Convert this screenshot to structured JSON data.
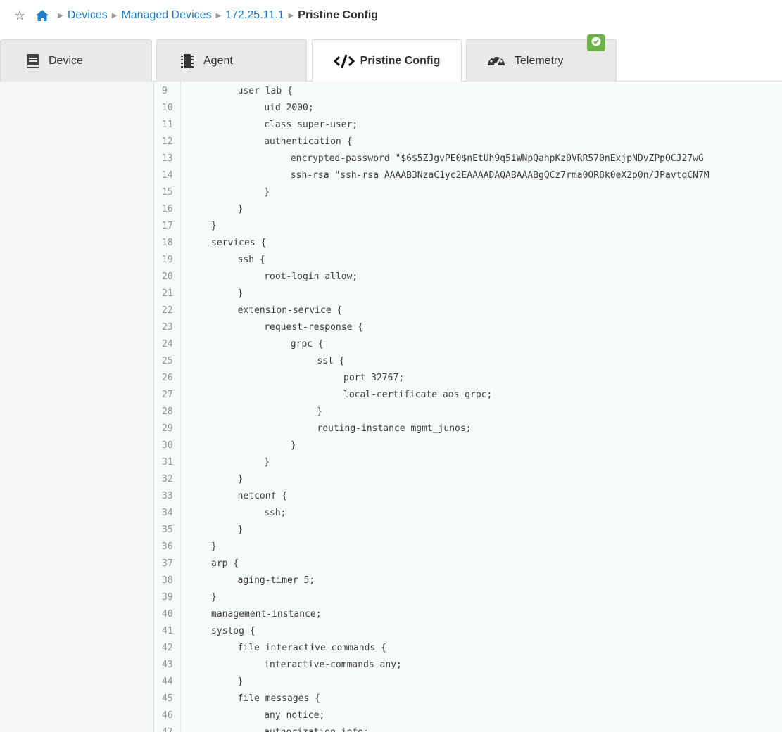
{
  "breadcrumb": {
    "items": [
      "Devices",
      "Managed Devices",
      "172.25.11.1"
    ],
    "current": "Pristine Config"
  },
  "tabs": [
    {
      "label": "Device",
      "icon": "book-icon"
    },
    {
      "label": "Agent",
      "icon": "chip-icon"
    },
    {
      "label": "Pristine Config",
      "icon": "code-icon",
      "active": true
    },
    {
      "label": "Telemetry",
      "icon": "gauge-icon"
    }
  ],
  "status_badge": {
    "icon": "check-circle-icon",
    "color": "#6bb342"
  },
  "code": {
    "lines": [
      {
        "n": "9",
        "indent": 4,
        "text": "user lab {"
      },
      {
        "n": "10",
        "indent": 8,
        "text": "uid 2000;"
      },
      {
        "n": "11",
        "indent": 8,
        "text": "class super-user;"
      },
      {
        "n": "12",
        "indent": 8,
        "text": "authentication {"
      },
      {
        "n": "13",
        "indent": 12,
        "text": "encrypted-password \"$6$5ZJgvPE0$nEtUh9q5iWNpQahpKz0VRR570nExjpNDvZPpOCJ27wG"
      },
      {
        "n": "14",
        "indent": 12,
        "text": "ssh-rsa \"ssh-rsa AAAAB3NzaC1yc2EAAAADAQABAAABgQCz7rma0OR8k0eX2p0n/JPavtqCN7M"
      },
      {
        "n": "15",
        "indent": 8,
        "text": "}"
      },
      {
        "n": "16",
        "indent": 4,
        "text": "}"
      },
      {
        "n": "17",
        "indent": 0,
        "text": "}"
      },
      {
        "n": "18",
        "indent": 0,
        "text": "services {"
      },
      {
        "n": "19",
        "indent": 4,
        "text": "ssh {"
      },
      {
        "n": "20",
        "indent": 8,
        "text": "root-login allow;"
      },
      {
        "n": "21",
        "indent": 4,
        "text": "}"
      },
      {
        "n": "22",
        "indent": 4,
        "text": "extension-service {"
      },
      {
        "n": "23",
        "indent": 8,
        "text": "request-response {"
      },
      {
        "n": "24",
        "indent": 12,
        "text": "grpc {"
      },
      {
        "n": "25",
        "indent": 16,
        "text": "ssl {"
      },
      {
        "n": "26",
        "indent": 20,
        "text": "port 32767;"
      },
      {
        "n": "27",
        "indent": 20,
        "text": "local-certificate aos_grpc;"
      },
      {
        "n": "28",
        "indent": 16,
        "text": "}"
      },
      {
        "n": "29",
        "indent": 16,
        "text": "routing-instance mgmt_junos;"
      },
      {
        "n": "30",
        "indent": 12,
        "text": "}"
      },
      {
        "n": "31",
        "indent": 8,
        "text": "}"
      },
      {
        "n": "32",
        "indent": 4,
        "text": "}"
      },
      {
        "n": "33",
        "indent": 4,
        "text": "netconf {"
      },
      {
        "n": "34",
        "indent": 8,
        "text": "ssh;"
      },
      {
        "n": "35",
        "indent": 4,
        "text": "}"
      },
      {
        "n": "36",
        "indent": 0,
        "text": "}"
      },
      {
        "n": "37",
        "indent": 0,
        "text": "arp {"
      },
      {
        "n": "38",
        "indent": 4,
        "text": "aging-timer 5;"
      },
      {
        "n": "39",
        "indent": 0,
        "text": "}"
      },
      {
        "n": "40",
        "indent": 0,
        "text": "management-instance;"
      },
      {
        "n": "41",
        "indent": 0,
        "text": "syslog {"
      },
      {
        "n": "42",
        "indent": 4,
        "text": "file interactive-commands {"
      },
      {
        "n": "43",
        "indent": 8,
        "text": "interactive-commands any;"
      },
      {
        "n": "44",
        "indent": 4,
        "text": "}"
      },
      {
        "n": "45",
        "indent": 4,
        "text": "file messages {"
      },
      {
        "n": "46",
        "indent": 8,
        "text": "any notice;"
      },
      {
        "n": "47",
        "indent": 8,
        "text": "authorization info;"
      }
    ]
  }
}
